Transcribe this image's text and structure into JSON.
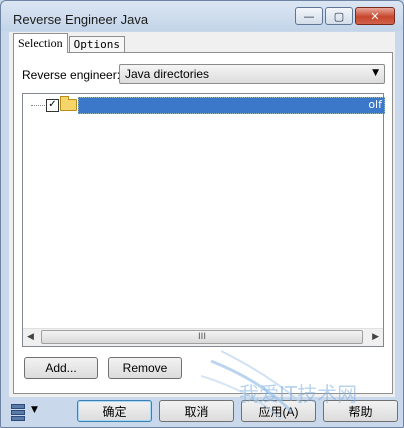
{
  "window": {
    "title": "Reverse Engineer Java"
  },
  "caption_buttons": {
    "minimize": "—",
    "maximize": "▢",
    "close": "✕"
  },
  "tabs": [
    {
      "label": "Selection"
    },
    {
      "label": "Options"
    }
  ],
  "selection": {
    "reverse_engineer_label": "Reverse engineer:",
    "reverse_engineer_value": "Java directories"
  },
  "tree": {
    "item_checked": true,
    "item_suffix": "olf"
  },
  "scrollbar": {
    "grip": "III"
  },
  "buttons": {
    "add": "Add...",
    "remove": "Remove",
    "ok": "确定",
    "cancel": "取消",
    "apply": "应用(A)",
    "help": "帮助"
  },
  "watermark": {
    "text": "我爱IT技术网"
  },
  "colors": {
    "selection": "#3b78c9",
    "accent": "#c7452d"
  }
}
